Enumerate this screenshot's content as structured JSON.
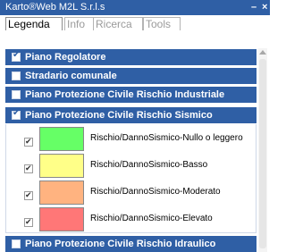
{
  "window": {
    "title": "Karto®Web M2L S.r.l.s",
    "minimize_glyph": "–",
    "close_glyph": "×"
  },
  "tabs": [
    {
      "label": "Legenda",
      "active": true
    },
    {
      "label": "Info",
      "active": false
    },
    {
      "label": "Ricerca",
      "active": false
    },
    {
      "label": "Tools",
      "active": false
    }
  ],
  "layers": [
    {
      "label": "Piano Regolatore",
      "checked": true
    },
    {
      "label": "Stradario comunale",
      "checked": false
    },
    {
      "label": "Piano Protezione Civile Rischio Industriale",
      "checked": false
    },
    {
      "label": "Piano Protezione Civile Rischio Sismico",
      "checked": true
    },
    {
      "label": "Piano Protezione Civile Rischio Idraulico",
      "checked": false
    }
  ],
  "sismico_legend": [
    {
      "label": "Rischio/DannoSismico-Nullo o leggero",
      "color": "#66ff66",
      "checked": true
    },
    {
      "label": "Rischio/DannoSismico-Basso",
      "color": "#ffff88",
      "checked": true
    },
    {
      "label": "Rischio/DannoSismico-Moderato",
      "color": "#ffb380",
      "checked": true
    },
    {
      "label": "Rischio/DannoSismico-Elevato",
      "color": "#ff7777",
      "checked": true
    }
  ],
  "colors": {
    "accent": "#2f5fa5"
  }
}
